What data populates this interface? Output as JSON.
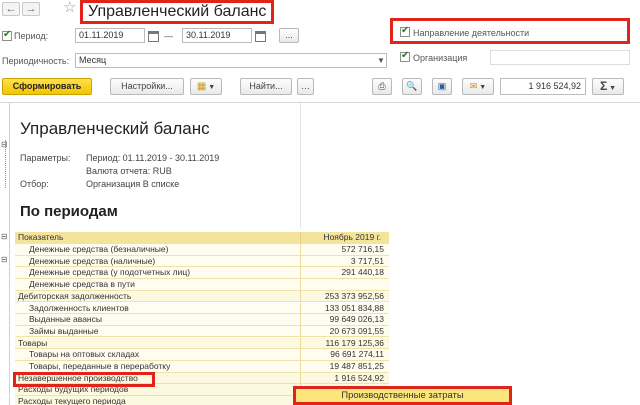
{
  "window": {
    "title": "Управленческий баланс"
  },
  "filters": {
    "period_label": "Период:",
    "period_from": "01.11.2019",
    "period_separator": "—",
    "period_to": "30.11.2019",
    "period_more": "...",
    "periodicity_label": "Периодичность:",
    "periodicity_value": "Месяц",
    "direction_label": "Направление деятельности",
    "organization_label": "Организация"
  },
  "toolbar": {
    "generate_label": "Сформировать",
    "settings_label": "Настройки...",
    "find_label": "Найти...",
    "sum_value": "1 916 524,92",
    "sigma": "Σ"
  },
  "report": {
    "title": "Управленческий баланс",
    "params_label": "Параметры:",
    "params_period": "Период: 01.11.2019 - 30.11.2019",
    "params_currency": "Валюта отчета: RUB",
    "selection_label": "Отбор:",
    "selection_value": "Организация В списке",
    "section_title": "По периодам",
    "col_indicator": "Показатель",
    "col_period": "Ноябрь 2019 г.",
    "rows": [
      {
        "name": "Денежные средства (безналичные)",
        "value": "572 716,15",
        "level": 2
      },
      {
        "name": "Денежные средства (наличные)",
        "value": "3 717,51",
        "level": 2
      },
      {
        "name": "Денежные средства (у подотчетных лиц)",
        "value": "291 440,18",
        "level": 2
      },
      {
        "name": "Денежные средства в пути",
        "value": "",
        "level": 2
      },
      {
        "name": "Дебиторская задолженность",
        "value": "253 373 952,56",
        "level": 1
      },
      {
        "name": "Задолженность клиентов",
        "value": "133 051 834,88",
        "level": 2
      },
      {
        "name": "Выданные авансы",
        "value": "99 649 026,13",
        "level": 2
      },
      {
        "name": "Займы выданные",
        "value": "20 673 091,55",
        "level": 2
      },
      {
        "name": "Товары",
        "value": "116 179 125,36",
        "level": 1
      },
      {
        "name": "Товары на оптовых складах",
        "value": "96 691 274,11",
        "level": 2
      },
      {
        "name": "Товары, переданные в переработку",
        "value": "19 487 851,25",
        "level": 2
      },
      {
        "name": "Незавершенное производство",
        "value": "1 916 524,92",
        "level": 1
      },
      {
        "name": "Расходы будущих периодов",
        "value": "",
        "level": 1
      },
      {
        "name": "Расходы текущего периода",
        "value": "",
        "level": 1
      }
    ],
    "tooltip": "Производственные затраты"
  }
}
